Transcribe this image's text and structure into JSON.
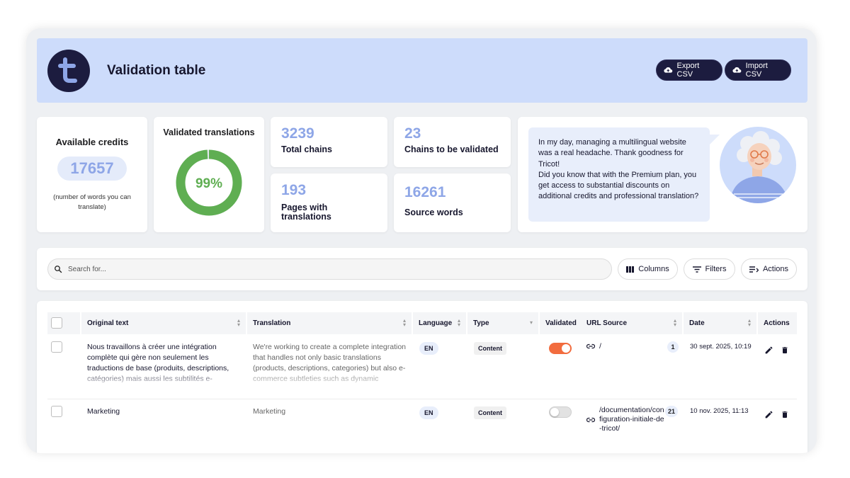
{
  "header": {
    "title": "Validation table",
    "export_label": "Export CSV",
    "import_label": "Import CSV"
  },
  "credits": {
    "title": "Available credits",
    "value": "17657",
    "note": "(number of words you can translate)"
  },
  "validated": {
    "title": "Validated translations",
    "percent_label": "99%",
    "percent": 99
  },
  "stats": [
    {
      "value": "3239",
      "label": "Total chains"
    },
    {
      "value": "23",
      "label": "Chains to be validated"
    },
    {
      "value": "193",
      "label": "Pages with translations"
    },
    {
      "value": "16261",
      "label": "Source words"
    }
  ],
  "promo": {
    "message": "In my day, managing a multilingual website was a real headache. Thank goodness for Tricot!\nDid you know that with the Premium plan, you get access to substantial discounts on additional credits and professional translation?"
  },
  "toolbar": {
    "search_placeholder": "Search for...",
    "columns_label": "Columns",
    "filters_label": "Filters",
    "actions_label": "Actions"
  },
  "table": {
    "columns": [
      "Original text",
      "Translation",
      "Language",
      "Type",
      "Validated",
      "URL Source",
      "Date",
      "Actions"
    ],
    "rows": [
      {
        "original": "Nous travaillons à créer une intégration complète qui gère non seulement les traductions de base (produits, descriptions, catégories) mais aussi les subtilités e-commerce comme les options de livraison",
        "translation": "We're working to create a complete integration that handles not only basic translations (products, descriptions, categories) but also e-commerce subtleties such as dynamic",
        "language": "EN",
        "type": "Content",
        "validated": true,
        "url": "/",
        "count": "1",
        "date": "30 sept. 2025, 10:19"
      },
      {
        "original": "Marketing",
        "translation": "Marketing",
        "language": "EN",
        "type": "Content",
        "validated": false,
        "url": "/documentation/configuration-initiale-de-tricot/",
        "count": "21",
        "date": "10 nov. 2025, 11:13"
      }
    ]
  },
  "colors": {
    "header_bg": "#cddcfb",
    "dark": "#1c1c3f",
    "accent_blue": "#8ea6e7",
    "donut_green": "#5fae52",
    "toggle_on": "#f26c3e"
  }
}
